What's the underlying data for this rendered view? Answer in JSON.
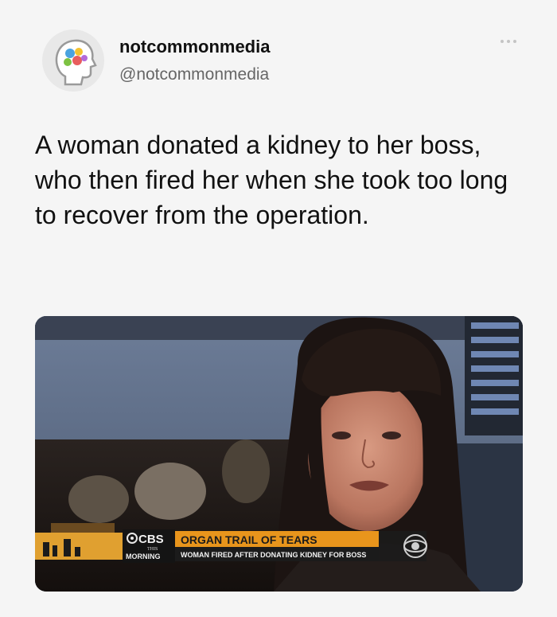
{
  "author": {
    "display_name": "notcommonmedia",
    "handle": "@notcommonmedia",
    "avatar_icon": "brain-profile-icon"
  },
  "menu": {
    "icon": "more-options-icon"
  },
  "tweet": {
    "text": "A woman donated a kidney to her boss, who then fired her when she took too long to recover from the operation."
  },
  "media": {
    "network_logo": "CBS",
    "network_sub": "THIS",
    "program": "MORNING",
    "headline": "ORGAN TRAIL OF TEARS",
    "subheadline": "WOMAN FIRED AFTER DONATING KIDNEY FOR BOSS",
    "colors": {
      "ticker_orange": "#e59a1a",
      "ticker_dark": "#1b1b1b"
    }
  }
}
